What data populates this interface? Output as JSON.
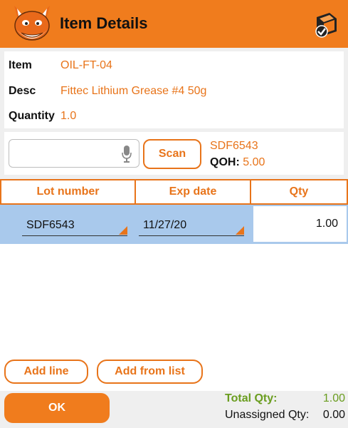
{
  "header": {
    "title": "Item Details",
    "logo_icon": "fox-mascot-icon",
    "action_icon": "printer-check-icon"
  },
  "item": {
    "item_label": "Item",
    "item_value": "OIL-FT-04",
    "desc_label": "Desc",
    "desc_value": "Fittec Lithium Grease #4 50g",
    "qty_label": "Quantity",
    "qty_value": "1.0"
  },
  "scan": {
    "placeholder": "",
    "button_label": "Scan",
    "lot": "SDF6543",
    "qoh_label": "QOH:",
    "qoh_value": "5.00"
  },
  "table": {
    "headers": [
      "Lot number",
      "Exp date",
      "Qty"
    ],
    "rows": [
      {
        "lot": "SDF6543",
        "exp": "11/27/20",
        "qty": "1.00"
      }
    ]
  },
  "actions": {
    "add_line": "Add line",
    "add_from_list": "Add from list"
  },
  "footer": {
    "ok_label": "OK",
    "total_label": "Total Qty:",
    "total_value": "1.00",
    "unassigned_label": "Unassigned Qty:",
    "unassigned_value": "0.00"
  },
  "colors": {
    "accent": "#f07c1d",
    "selected_row": "#a9c9ec",
    "total": "#6a9d1f"
  }
}
